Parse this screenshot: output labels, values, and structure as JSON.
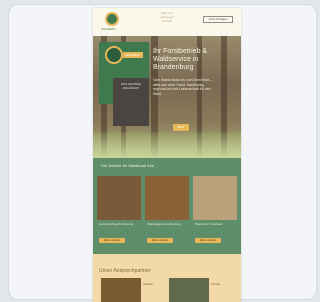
{
  "header": {
    "logo_text": "WALDBAU",
    "nav": [
      "Über uns",
      "Leistungen",
      "Kontakt"
    ],
    "button_label": "Jetzt Anfragen"
  },
  "hero": {
    "badge_tag": "WALDBAU",
    "poster_text": "DAS GROSSE WALDFEST",
    "title": "Ihr Forstbetrieb & Waldservice in Brandenburg",
    "text": "Vom Waldumbau bis zum Brennholz – alles aus einer Hand. Nachhaltig, regional und mit Leidenschaft für den Wald.",
    "cta_label": "Mehr"
  },
  "services": {
    "title": "Die Vorteile Ihr Waldbund Ihre",
    "items": [
      {
        "caption": "Holzeinschlag & Rückung",
        "button": "Mehr erfahren"
      },
      {
        "caption": "Waldpflege & Aufforstung",
        "button": "Mehr erfahren"
      },
      {
        "caption": "Brennholz & Verkauf",
        "button": "Mehr erfahren"
      }
    ]
  },
  "team": {
    "title": "Unser Ansprechpartner",
    "people": [
      {
        "caption": "Inhaber"
      },
      {
        "caption": "Förster"
      }
    ]
  },
  "colors": {
    "green": "#5e8f6a",
    "accent": "#e8b75a",
    "beige": "#f4d9a8"
  }
}
